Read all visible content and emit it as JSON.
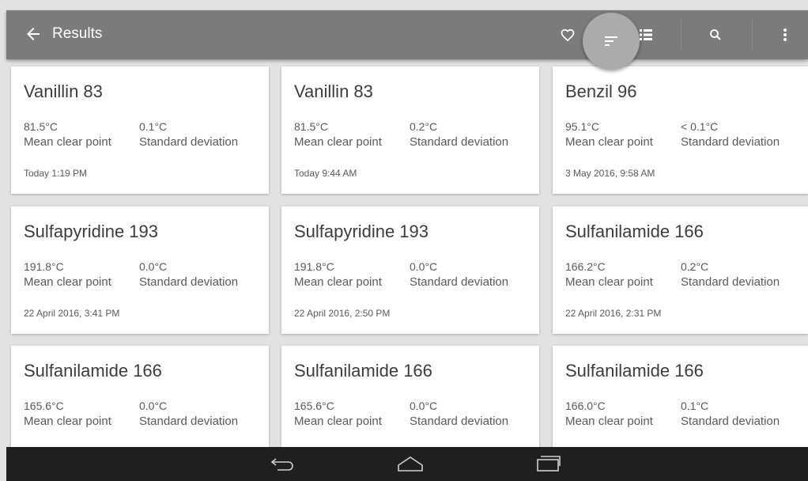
{
  "appbar": {
    "title": "Results",
    "icons": [
      "arrow-back-icon",
      "heart-outline-icon",
      "sort-icon",
      "list-view-icon",
      "search-icon",
      "more-vert-icon"
    ]
  },
  "results": [
    {
      "name": "Vanillin 83",
      "mean_value": "81.5°C",
      "mean_label": "Mean clear point",
      "sd_value": "0.1°C",
      "sd_label": "Standard deviation",
      "timestamp": "Today 1:19 PM"
    },
    {
      "name": "Vanillin 83",
      "mean_value": "81.5°C",
      "mean_label": "Mean clear point",
      "sd_value": "0.2°C",
      "sd_label": "Standard deviation",
      "timestamp": "Today 9:44 AM"
    },
    {
      "name": "Benzil 96",
      "mean_value": "95.1°C",
      "mean_label": "Mean clear point",
      "sd_value": "< 0.1°C",
      "sd_label": "Standard deviation",
      "timestamp": "3 May 2016, 9:58 AM"
    },
    {
      "name": "Sulfapyridine 193",
      "mean_value": "191.8°C",
      "mean_label": "Mean clear point",
      "sd_value": "0.0°C",
      "sd_label": "Standard deviation",
      "timestamp": "22 April 2016, 3:41 PM"
    },
    {
      "name": "Sulfapyridine 193",
      "mean_value": "191.8°C",
      "mean_label": "Mean clear point",
      "sd_value": "0.0°C",
      "sd_label": "Standard deviation",
      "timestamp": "22 April 2016, 2:50 PM"
    },
    {
      "name": "Sulfanilamide 166",
      "mean_value": "166.2°C",
      "mean_label": "Mean clear point",
      "sd_value": "0.2°C",
      "sd_label": "Standard deviation",
      "timestamp": "22 April 2016, 2:31 PM"
    },
    {
      "name": "Sulfanilamide 166",
      "mean_value": "165.6°C",
      "mean_label": "Mean clear point",
      "sd_value": "0.0°C",
      "sd_label": "Standard deviation",
      "timestamp": ""
    },
    {
      "name": "Sulfanilamide 166",
      "mean_value": "165.6°C",
      "mean_label": "Mean clear point",
      "sd_value": "0.0°C",
      "sd_label": "Standard deviation",
      "timestamp": ""
    },
    {
      "name": "Sulfanilamide 166",
      "mean_value": "166.0°C",
      "mean_label": "Mean clear point",
      "sd_value": "0.1°C",
      "sd_label": "Standard deviation",
      "timestamp": ""
    }
  ],
  "navbar": {
    "icons": [
      "nav-back-icon",
      "nav-home-icon",
      "nav-recents-icon"
    ]
  },
  "colors": {
    "appbar": "#7b7b7b",
    "background": "#e2e2e2",
    "card": "#ffffff",
    "navbar": "#1f1f1f"
  }
}
